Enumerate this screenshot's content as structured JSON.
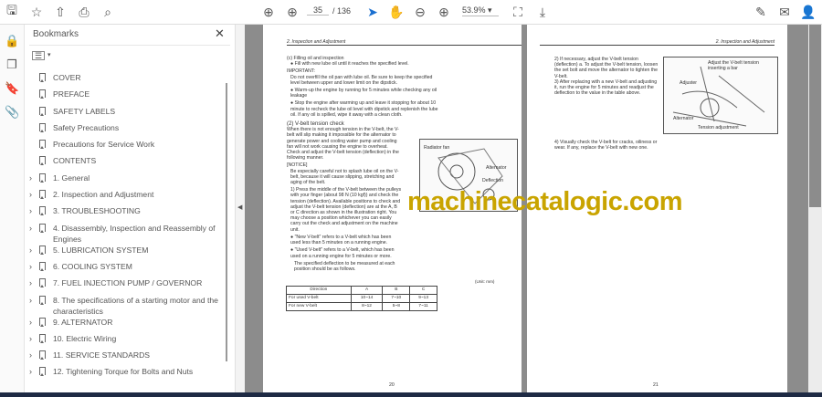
{
  "toolbar": {
    "page_current": "35",
    "page_total": "/ 136",
    "zoom": "53.9%"
  },
  "bookmarks": {
    "title": "Bookmarks",
    "items": [
      {
        "label": "COVER",
        "expandable": false
      },
      {
        "label": "PREFACE",
        "expandable": false
      },
      {
        "label": "SAFETY LABELS",
        "expandable": false
      },
      {
        "label": "Safety Precautions",
        "expandable": false
      },
      {
        "label": "Precautions for Service Work",
        "expandable": false
      },
      {
        "label": "CONTENTS",
        "expandable": false
      },
      {
        "label": "1.  General",
        "expandable": true
      },
      {
        "label": "2. Inspection and Adjustment",
        "expandable": true
      },
      {
        "label": "3. TROUBLESHOOTING",
        "expandable": true
      },
      {
        "label": "4. Disassembly, Inspection and Reassembly of Engines",
        "expandable": true
      },
      {
        "label": "5. LUBRICATION SYSTEM",
        "expandable": true
      },
      {
        "label": "6. COOLING SYSTEM",
        "expandable": true
      },
      {
        "label": "7. FUEL INJECTION PUMP / GOVERNOR",
        "expandable": true
      },
      {
        "label": "8. The specifications of a starting motor and the characteristics",
        "expandable": true
      },
      {
        "label": "9. ALTERNATOR",
        "expandable": true
      },
      {
        "label": "10. Electric Wiring",
        "expandable": true
      },
      {
        "label": "11. SERVICE STANDARDS",
        "expandable": true
      },
      {
        "label": "12. Tightening Torque for Bolts and Nuts",
        "expandable": true
      }
    ]
  },
  "left_page": {
    "header": "2. Inspection and Adjustment",
    "s1": "(c) Filling oil and inspection",
    "s1b": "● Fill with new lube oil until it reaches the specified level.",
    "imp": "IMPORTANT:",
    "imp1": "Do not overfill the oil pan with lube oil. Be sure to keep the specified level between upper and lower limit on the dipstick.",
    "b1": "● Warm-up the engine by running for 5 minutes while checking any oil leakage",
    "b2": "● Stop the engine after warming up and leave it stopping for about 10 minute to recheck the lube oil level with dipstick and replenish the lube oil.   If any oil is spilled, wipe it away with a clean cloth.",
    "s2": "(2) V-belt tension check",
    "s2p": "When there is not enough tension in the V-belt, the V-belt will slip making it impossible for the alternator to generate power and cooling water pump and cooling fan will not work causing the engine to overheat. Check and adjust the V-belt tension (deflection) in the following manner.",
    "notice": "[NOTICE]",
    "notice1": "Be especially careful not to splash lube oil on the V-belt, because it will cause slipping, stretching and aging of the belt.",
    "step1": "1) Press the middle of the V-belt between the pulleys with your finger (about 98 N (10 kgf)) and check the tension (deflection). Available positions to check and adjust the V-belt tension (deflection) are at the A, B or C direction as shown in the illustration right. You may choose a position whichever you can easily carry out the check and adjustment on the machine unit.",
    "b3": "● \"New V-belt\" refers to a V-belt which has been used less than 5 minutes on a running engine.",
    "b4": "● \"Used V-belt\" refers to a V-belt, which has been used on a running engine for 5 minutes or more.",
    "spec": "The specified deflection to be measured at each position should be as follows.",
    "fig_labels": [
      "Radiator fan",
      "Alternator",
      "Deflection"
    ],
    "unit": "(Unit: mm)",
    "table": {
      "headers": [
        "Direction",
        "A",
        "B",
        "C"
      ],
      "rows": [
        [
          "For used V-belt",
          "10~14",
          "7~10",
          "9~13"
        ],
        [
          "For new V-belt",
          "8~12",
          "5~8",
          "7~11"
        ]
      ]
    },
    "page_no": "20"
  },
  "right_page": {
    "header": "2. Inspection and Adjustment",
    "step2": "2) If necessary, adjust the V-belt tension (deflection) a.   To adjust the V-belt tension, loosen the set bolt and move the alternator to tighten the V-belt.",
    "step3": "3) After replacing with a new V-belt and adjusting it, run the engine for 5 minutes and readjust the deflection to the value in the table above.",
    "step4": "4) Visually check the V-belt for cracks, oiliness or wear.    If any, replace the V-belt with new one.",
    "fig_labels": [
      "Adjust the V-belt tension inserting a bar",
      "Adjuster",
      "Alternator",
      "Tension adjustment"
    ],
    "page_no": "21"
  },
  "watermark": "machinecatalogic.com"
}
